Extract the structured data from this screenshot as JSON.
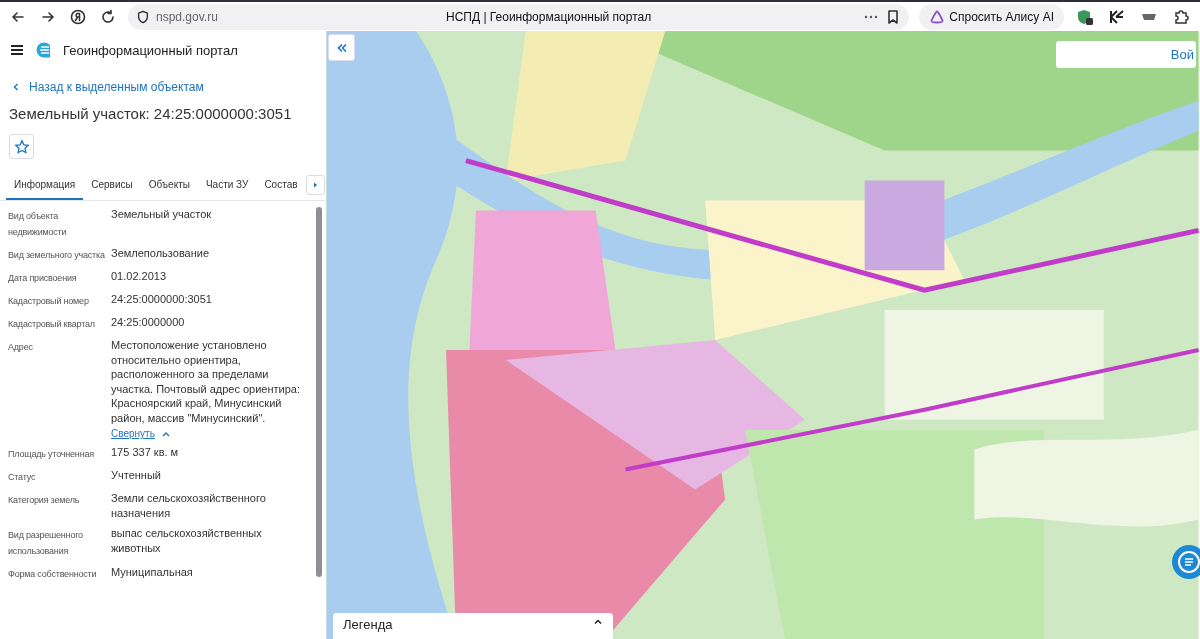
{
  "browser": {
    "url": "nspd.gov.ru",
    "tab_title": "НСПД | Геоинформационный портал",
    "assistant_button": "Спросить Алису AI"
  },
  "app": {
    "title": "Геоинформационный портал"
  },
  "back_link": "Назад к выделенным объектам",
  "object_title": "Земельный участок: 24:25:0000000:3051",
  "favorite": {
    "on": false
  },
  "tabs": [
    {
      "label": "Информация",
      "selected": true
    },
    {
      "label": "Сервисы",
      "selected": false
    },
    {
      "label": "Объекты",
      "selected": false
    },
    {
      "label": "Части ЗУ",
      "selected": false
    },
    {
      "label": "Состав",
      "selected": false
    }
  ],
  "properties": [
    {
      "label": "Вид объекта недвижимости",
      "value": "Земельный участок"
    },
    {
      "label": "Вид земельного участка",
      "value": "Землепользование"
    },
    {
      "label": "Дата присвоения",
      "value": "01.02.2013"
    },
    {
      "label": "Кадастровый номер",
      "value": "24:25:0000000:3051"
    },
    {
      "label": "Кадастровый квартал",
      "value": "24:25:0000000"
    },
    {
      "label": "Адрес",
      "value": "Местоположение установлено относительно ориентира, расположенного за пределами участка. Почтовый адрес ориентира: Красноярский край, Минусинский район, массив \"Минусинский\".",
      "toggle": "Свернуть"
    },
    {
      "label": "Площадь уточненная",
      "value": "175 337 кв. м"
    },
    {
      "label": "Статус",
      "value": "Учтенный"
    },
    {
      "label": "Категория земель",
      "value": "Земли сельскохозяйственного назначения"
    },
    {
      "label": "Вид разрешенного использования",
      "value": "выпас сельскохозяйственных животных"
    },
    {
      "label": "Форма собственности",
      "value": "Муниципальная"
    }
  ],
  "map": {
    "kind": "picture",
    "top_right_button": "Вой",
    "legend": {
      "title": "Легенда",
      "expanded": false
    }
  }
}
